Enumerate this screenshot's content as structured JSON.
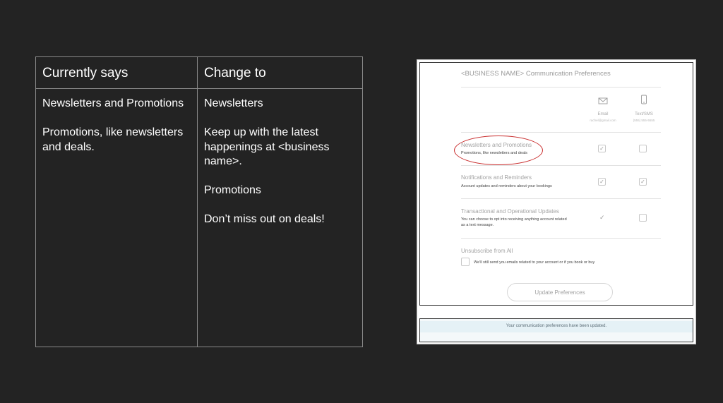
{
  "comparison": {
    "headers": [
      "Currently says",
      "Change to"
    ],
    "current": [
      "Newsletters and Promotions",
      "Promotions, like newsletters and deals."
    ],
    "change_to": [
      "Newsletters",
      "Keep up with the latest happenings at <business name>.",
      "Promotions",
      "Don’t miss out on deals!"
    ]
  },
  "preferences": {
    "title": "<BUSINESS NAME> Communication Preferences",
    "channels": [
      {
        "label": "Email",
        "detail": "rachel@gmail.com",
        "icon": "envelope-icon"
      },
      {
        "label": "Text/SMS",
        "detail": "(555) 555-5555",
        "icon": "phone-icon"
      }
    ],
    "rows": [
      {
        "title": "Newsletters and Promotions",
        "description": "Promotions, like newsletters and deals",
        "email": true,
        "sms": false,
        "highlighted": true
      },
      {
        "title": "Notifications and Reminders",
        "description": "Account updates and reminders about your bookings",
        "email": true,
        "sms": true
      },
      {
        "title": "Transactional and Operational Updates",
        "description_lines": [
          "You can choose to opt into receiving anything account related",
          "as a text message."
        ],
        "email": true,
        "email_locked": true,
        "sms": false
      }
    ],
    "unsubscribe": {
      "title": "Unsubscribe from All",
      "description": "We'll still send you emails related to your account or if you book or buy",
      "checked": false
    },
    "button_label": "Update Preferences",
    "confirmation": "Your communication preferences have been updated.",
    "colors": {
      "highlight_ring": "#c92d2d",
      "notice_bg": "#e5f1f6"
    }
  }
}
